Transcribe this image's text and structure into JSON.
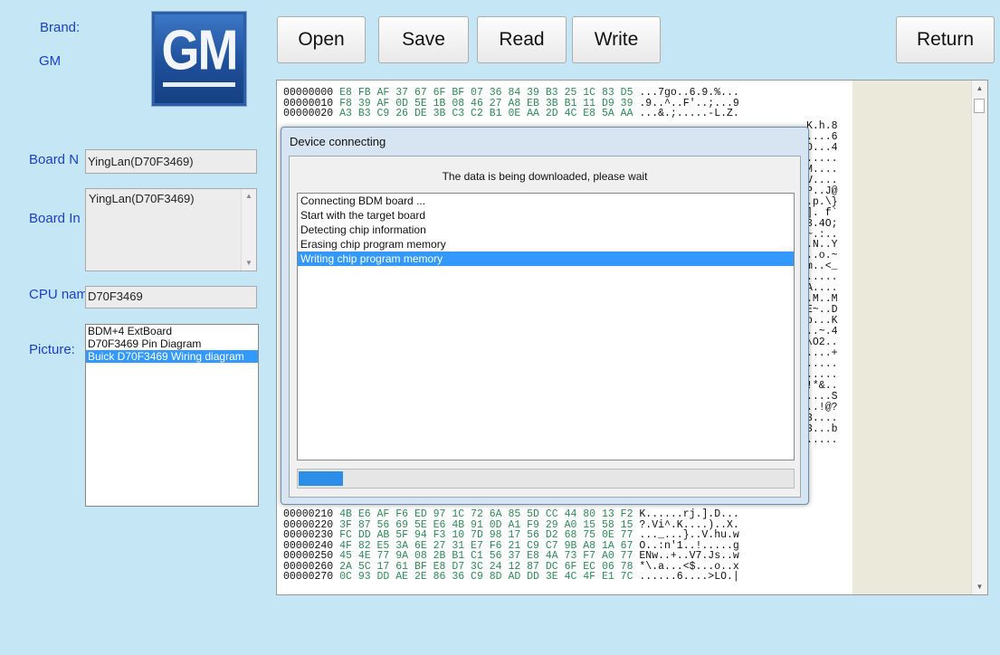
{
  "brand": {
    "label": "Brand:",
    "value": "GM",
    "logo_text": "GM"
  },
  "left_panel": {
    "board_name_label": "Board N",
    "board_name_value": "YingLan(D70F3469)",
    "board_info_label": "Board In",
    "board_info_value": "YingLan(D70F3469)",
    "cpu_name_label": "CPU nam",
    "cpu_name_value": "D70F3469",
    "picture_label": "Picture:",
    "pictures": [
      {
        "label": "BDM+4 ExtBoard",
        "selected": false
      },
      {
        "label": "D70F3469 Pin Diagram",
        "selected": false
      },
      {
        "label": "Buick D70F3469 Wiring diagram",
        "selected": true
      }
    ]
  },
  "toolbar": {
    "open_label": "Open",
    "save_label": "Save",
    "read_label": "Read",
    "write_label": "Write",
    "return_label": "Return"
  },
  "hex": {
    "top_rows": [
      {
        "addr": "00000000",
        "hex": "E8 FB AF 37 67 6F BF 07 36 84 39 B3 25 1C 83 D5",
        "ascii": "...7go..6.9.%..."
      },
      {
        "addr": "00000010",
        "hex": "F8 39 AF 0D 5E 1B 08 46 27 A8 EB 3B B1 11 D9 39",
        "ascii": ".9..^..F'..;...9"
      },
      {
        "addr": "00000020",
        "hex": "A3 B3 C9 26 DE 3B C3 C2 B1 0E AA 2D 4C E8 5A AA",
        "ascii": "...&.;.....-L.Z."
      }
    ],
    "right_col": [
      "K.h.8",
      "....6",
      "O...4",
      ".....",
      "M....",
      "V....",
      "P..J@",
      ".p.\\}",
      "]. f`",
      "3.4O;",
      "~.:..",
      ".N..Y",
      "..o.~",
      "m..<_",
      ".....",
      "A....",
      ".M..M",
      "E~..D",
      "b...K",
      "..~.4",
      "\\O2..",
      "....+",
      ".....",
      ".....",
      "!*&..",
      "....S",
      "..!@?",
      "3....",
      "3...b",
      "....."
    ],
    "bottom_rows": [
      {
        "addr": "00000210",
        "hex": "4B E6 AF F6 ED 97 1C 72 6A 85 5D CC 44 80 13 F2",
        "ascii": "K......rj.].D..."
      },
      {
        "addr": "00000220",
        "hex": "3F 87 56 69 5E E6 4B 91 0D A1 F9 29 A0 15 58 15",
        "ascii": "?.Vi^.K....)..X."
      },
      {
        "addr": "00000230",
        "hex": "FC DD AB 5F 94 F3 10 7D 98 17 56 D2 68 75 0E 77",
        "ascii": "..._...}..V.hu.w"
      },
      {
        "addr": "00000240",
        "hex": "4F 82 E5 3A 6E 27 31 E7 F6 21 C9 C7 9B A8 1A 67",
        "ascii": "O..:n'1..!.....g"
      },
      {
        "addr": "00000250",
        "hex": "45 4E 77 9A 08 2B B1 C1 56 37 E8 4A 73 F7 A0 77",
        "ascii": "ENw..+..V7.Js..w"
      },
      {
        "addr": "00000260",
        "hex": "2A 5C 17 61 BF E8 D7 3C 24 12 87 DC 6F EC 06 78",
        "ascii": "*\\.a...<$...o..x"
      },
      {
        "addr": "00000270",
        "hex": "0C 93 DD AE 2E 86 36 C9 8D AD DD 3E 4C 4F E1 7C",
        "ascii": "......6....>LO.|"
      }
    ]
  },
  "dialog": {
    "title": "Device connecting",
    "message": "The data is being downloaded, please wait",
    "log": [
      {
        "text": "Connecting BDM board ...",
        "selected": false
      },
      {
        "text": "Start with the target board",
        "selected": false
      },
      {
        "text": "Detecting chip information",
        "selected": false
      },
      {
        "text": "Erasing chip program memory",
        "selected": false
      },
      {
        "text": "Writing chip program memory",
        "selected": true
      }
    ],
    "progress": 0.09
  }
}
